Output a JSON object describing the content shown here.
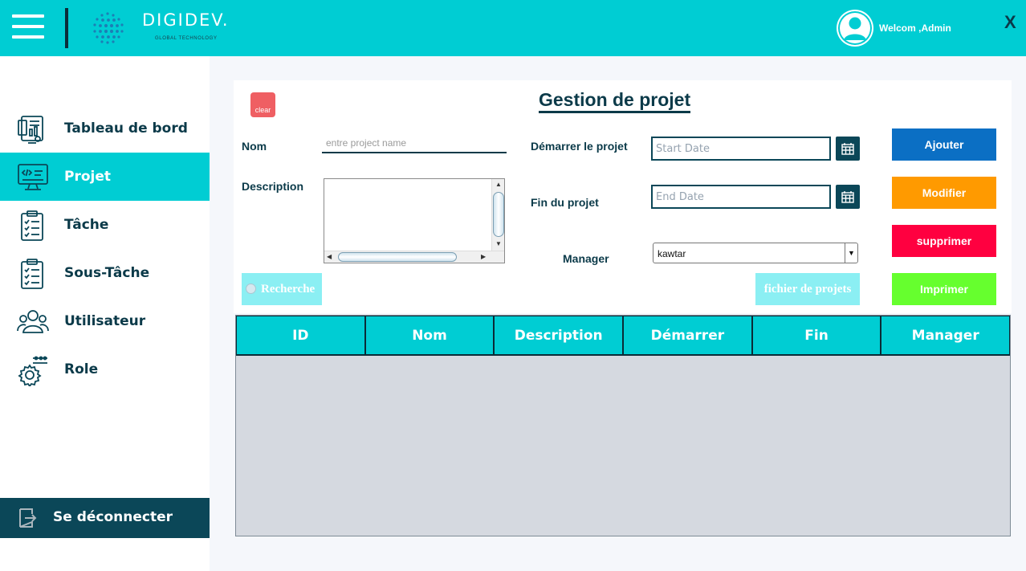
{
  "header": {
    "logo_text": "DIGIDEV.",
    "logo_subtitle": "GLOBAL TECHNOLOGY",
    "welcome": "Welcom ,Admin",
    "close_label": "X"
  },
  "sidebar": {
    "items": [
      {
        "label": "Tableau de bord",
        "icon": "dashboard-icon",
        "active": false
      },
      {
        "label": "Projet",
        "icon": "monitor-code-icon",
        "active": true
      },
      {
        "label": "Tâche",
        "icon": "clipboard-checklist-icon",
        "active": false
      },
      {
        "label": "Sous-Tâche",
        "icon": "clipboard-checklist-icon",
        "active": false
      },
      {
        "label": "Utilisateur",
        "icon": "users-icon",
        "active": false
      },
      {
        "label": "Role",
        "icon": "gear-settings-icon",
        "active": false
      }
    ],
    "logout_label": "Se déconnecter"
  },
  "form": {
    "title": "Gestion de projet",
    "clear_label": "clear",
    "nom_label": "Nom",
    "nom_placeholder": "entre project name",
    "nom_value": "",
    "description_label": "Description",
    "description_value": "",
    "start_label": "Démarrer le projet",
    "start_placeholder": "Start Date",
    "end_label": "Fin du projet",
    "end_placeholder": "End Date",
    "manager_label": "Manager",
    "manager_value": "kawtar",
    "search_label": "Recherche",
    "file_label": "fichier de projets"
  },
  "actions": {
    "ajouter": "Ajouter",
    "modifier": "Modifier",
    "supprimer": "supprimer",
    "imprimer": "Imprimer"
  },
  "colors": {
    "accent": "#00cdd3",
    "dark": "#0b3a49",
    "ajouter": "#0b6fc4",
    "modifier": "#ff9a00",
    "supprimer": "#ff0040",
    "imprimer": "#66ff2e"
  },
  "table": {
    "columns": [
      "ID",
      "Nom",
      "Description",
      "Démarrer",
      "Fin",
      "Manager"
    ],
    "rows": []
  }
}
